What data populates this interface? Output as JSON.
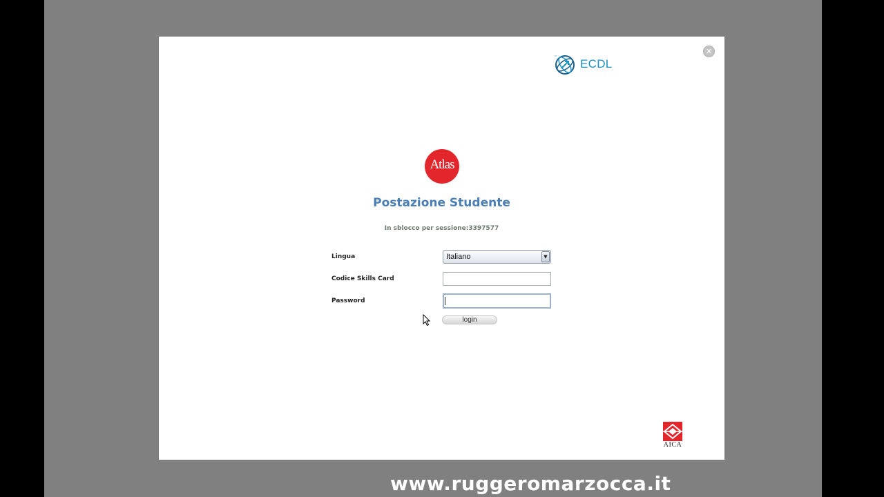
{
  "dialog": {
    "close_symbol": "✕",
    "ecdl_logo": {
      "text": "ECDL",
      "trademark": "™"
    },
    "atlas_logo": {
      "text": "Atlas"
    },
    "title": "Postazione Studente",
    "session_info": "In sblocco per sessione:3397577",
    "form": {
      "lingua_label": "Lingua",
      "lingua_value": "Italiano",
      "codice_label": "Codice Skills Card",
      "codice_value": "",
      "password_label": "Password",
      "password_value": "",
      "login_label": "login"
    },
    "aica_logo": {
      "text": "AICA"
    }
  },
  "watermark": "www.ruggeromarzocca.it",
  "colors": {
    "title": "#4a7fb5",
    "atlas_red": "#e3262b",
    "ecdl_blue": "#1b8fc0",
    "aica_red": "#e3262b",
    "frame_gray": "#808080"
  }
}
